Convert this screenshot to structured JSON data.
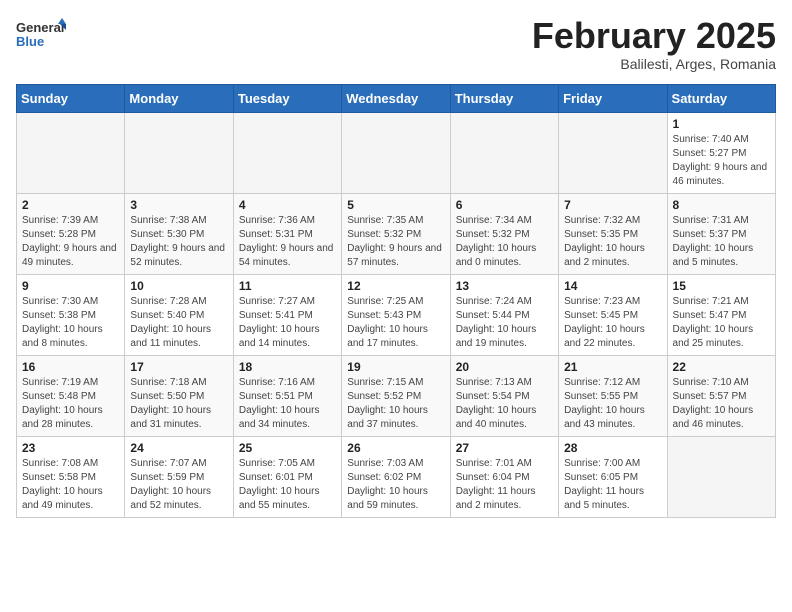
{
  "header": {
    "logo_general": "General",
    "logo_blue": "Blue",
    "month_title": "February 2025",
    "location": "Balilesti, Arges, Romania"
  },
  "calendar": {
    "days_of_week": [
      "Sunday",
      "Monday",
      "Tuesday",
      "Wednesday",
      "Thursday",
      "Friday",
      "Saturday"
    ],
    "weeks": [
      [
        {
          "day": "",
          "info": ""
        },
        {
          "day": "",
          "info": ""
        },
        {
          "day": "",
          "info": ""
        },
        {
          "day": "",
          "info": ""
        },
        {
          "day": "",
          "info": ""
        },
        {
          "day": "",
          "info": ""
        },
        {
          "day": "1",
          "info": "Sunrise: 7:40 AM\nSunset: 5:27 PM\nDaylight: 9 hours and 46 minutes."
        }
      ],
      [
        {
          "day": "2",
          "info": "Sunrise: 7:39 AM\nSunset: 5:28 PM\nDaylight: 9 hours and 49 minutes."
        },
        {
          "day": "3",
          "info": "Sunrise: 7:38 AM\nSunset: 5:30 PM\nDaylight: 9 hours and 52 minutes."
        },
        {
          "day": "4",
          "info": "Sunrise: 7:36 AM\nSunset: 5:31 PM\nDaylight: 9 hours and 54 minutes."
        },
        {
          "day": "5",
          "info": "Sunrise: 7:35 AM\nSunset: 5:32 PM\nDaylight: 9 hours and 57 minutes."
        },
        {
          "day": "6",
          "info": "Sunrise: 7:34 AM\nSunset: 5:32 PM\nDaylight: 10 hours and 0 minutes."
        },
        {
          "day": "7",
          "info": "Sunrise: 7:32 AM\nSunset: 5:35 PM\nDaylight: 10 hours and 2 minutes."
        },
        {
          "day": "8",
          "info": "Sunrise: 7:31 AM\nSunset: 5:37 PM\nDaylight: 10 hours and 5 minutes."
        }
      ],
      [
        {
          "day": "9",
          "info": "Sunrise: 7:30 AM\nSunset: 5:38 PM\nDaylight: 10 hours and 8 minutes."
        },
        {
          "day": "10",
          "info": "Sunrise: 7:28 AM\nSunset: 5:40 PM\nDaylight: 10 hours and 11 minutes."
        },
        {
          "day": "11",
          "info": "Sunrise: 7:27 AM\nSunset: 5:41 PM\nDaylight: 10 hours and 14 minutes."
        },
        {
          "day": "12",
          "info": "Sunrise: 7:25 AM\nSunset: 5:43 PM\nDaylight: 10 hours and 17 minutes."
        },
        {
          "day": "13",
          "info": "Sunrise: 7:24 AM\nSunset: 5:44 PM\nDaylight: 10 hours and 19 minutes."
        },
        {
          "day": "14",
          "info": "Sunrise: 7:23 AM\nSunset: 5:45 PM\nDaylight: 10 hours and 22 minutes."
        },
        {
          "day": "15",
          "info": "Sunrise: 7:21 AM\nSunset: 5:47 PM\nDaylight: 10 hours and 25 minutes."
        }
      ],
      [
        {
          "day": "16",
          "info": "Sunrise: 7:19 AM\nSunset: 5:48 PM\nDaylight: 10 hours and 28 minutes."
        },
        {
          "day": "17",
          "info": "Sunrise: 7:18 AM\nSunset: 5:50 PM\nDaylight: 10 hours and 31 minutes."
        },
        {
          "day": "18",
          "info": "Sunrise: 7:16 AM\nSunset: 5:51 PM\nDaylight: 10 hours and 34 minutes."
        },
        {
          "day": "19",
          "info": "Sunrise: 7:15 AM\nSunset: 5:52 PM\nDaylight: 10 hours and 37 minutes."
        },
        {
          "day": "20",
          "info": "Sunrise: 7:13 AM\nSunset: 5:54 PM\nDaylight: 10 hours and 40 minutes."
        },
        {
          "day": "21",
          "info": "Sunrise: 7:12 AM\nSunset: 5:55 PM\nDaylight: 10 hours and 43 minutes."
        },
        {
          "day": "22",
          "info": "Sunrise: 7:10 AM\nSunset: 5:57 PM\nDaylight: 10 hours and 46 minutes."
        }
      ],
      [
        {
          "day": "23",
          "info": "Sunrise: 7:08 AM\nSunset: 5:58 PM\nDaylight: 10 hours and 49 minutes."
        },
        {
          "day": "24",
          "info": "Sunrise: 7:07 AM\nSunset: 5:59 PM\nDaylight: 10 hours and 52 minutes."
        },
        {
          "day": "25",
          "info": "Sunrise: 7:05 AM\nSunset: 6:01 PM\nDaylight: 10 hours and 55 minutes."
        },
        {
          "day": "26",
          "info": "Sunrise: 7:03 AM\nSunset: 6:02 PM\nDaylight: 10 hours and 59 minutes."
        },
        {
          "day": "27",
          "info": "Sunrise: 7:01 AM\nSunset: 6:04 PM\nDaylight: 11 hours and 2 minutes."
        },
        {
          "day": "28",
          "info": "Sunrise: 7:00 AM\nSunset: 6:05 PM\nDaylight: 11 hours and 5 minutes."
        },
        {
          "day": "",
          "info": ""
        }
      ]
    ]
  }
}
